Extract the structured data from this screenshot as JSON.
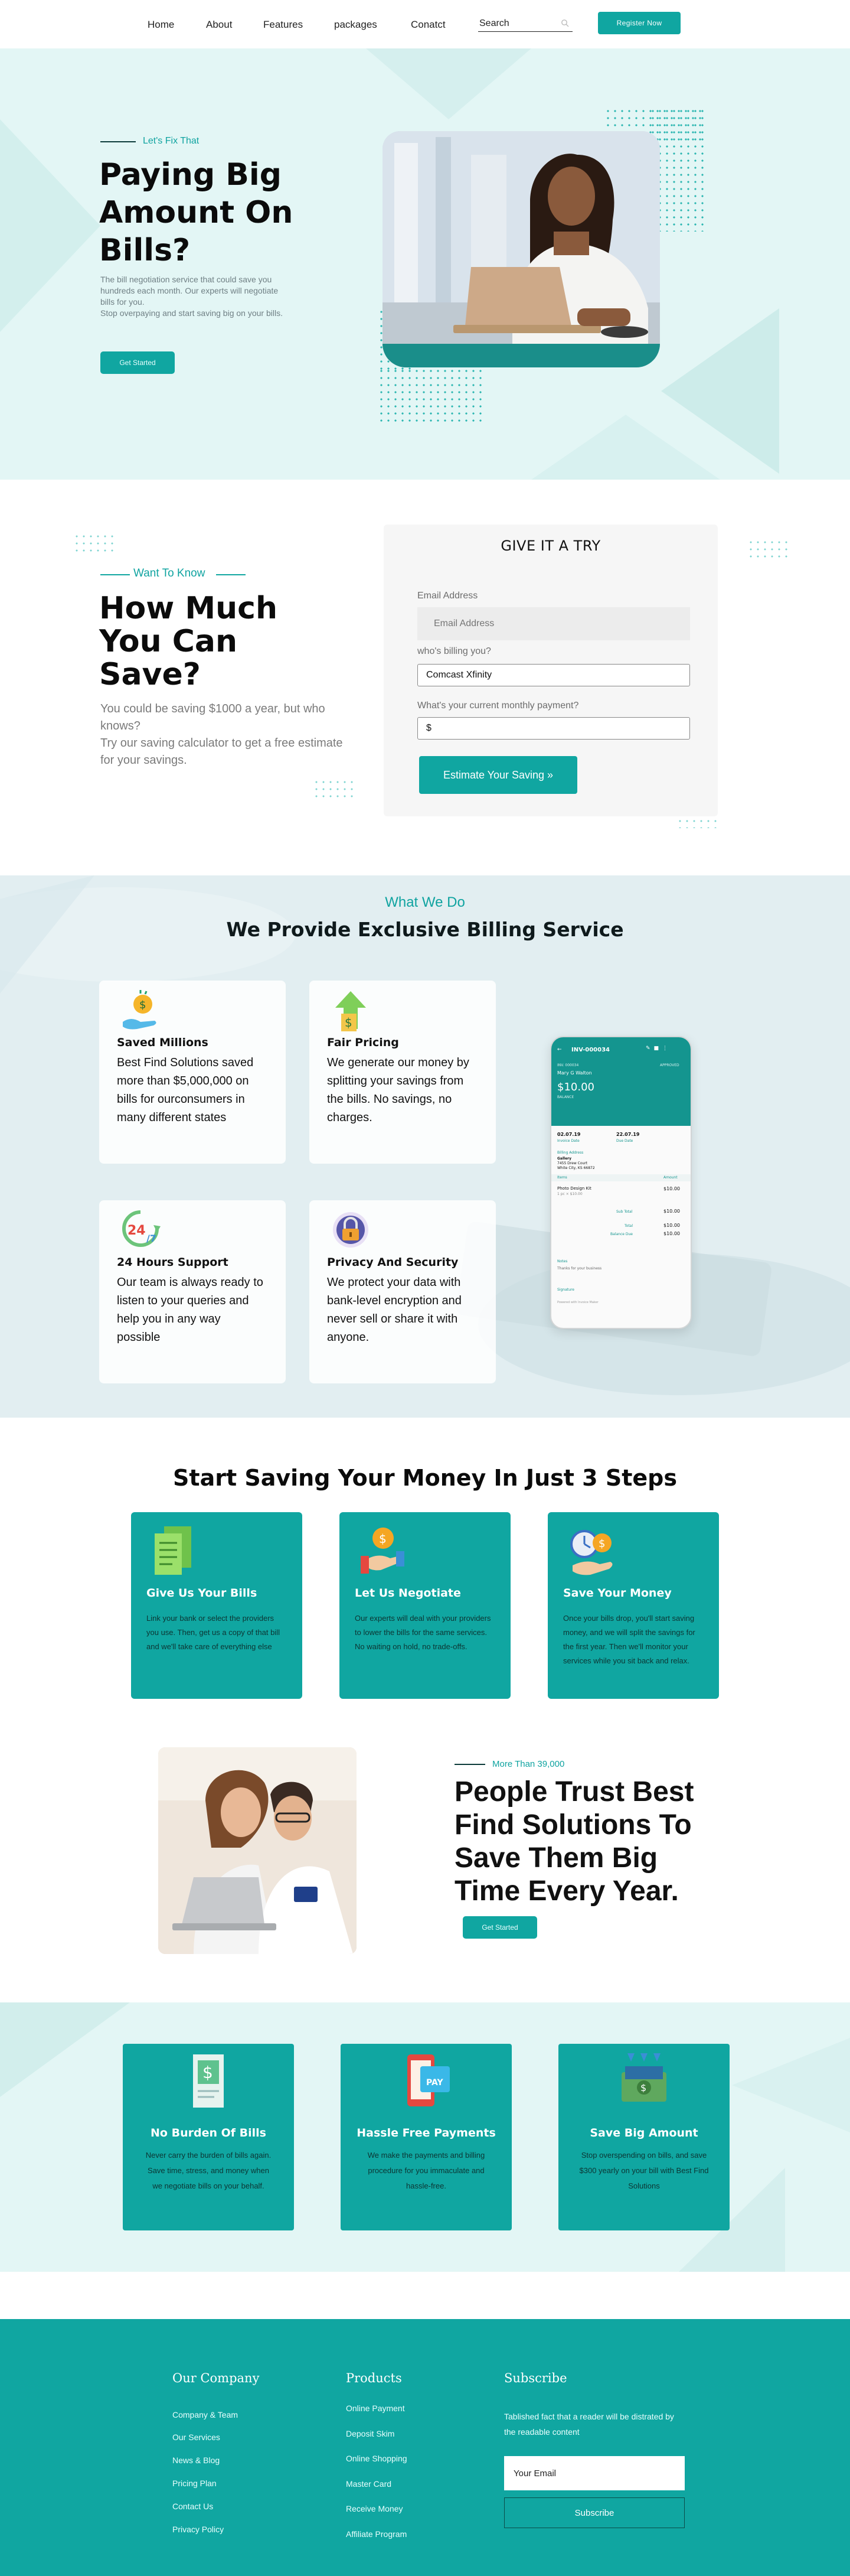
{
  "nav": {
    "links": [
      "Home",
      "About",
      "Features",
      "packages",
      "Conatct"
    ],
    "search_placeholder": "Search",
    "register_label": "Register Now"
  },
  "hero": {
    "tag": "Let's Fix That",
    "title": "Paying Big Amount On Bills?",
    "description": "The bill negotiation service that could save you hundreds each month. Our experts will negotiate bills for you.\nStop overpaying and start saving big on your bills.",
    "button_label": "Get Started"
  },
  "calculator": {
    "tag": "Want To Know",
    "title": "How Much You Can Save?",
    "description": "You could be saving $1000 a year, but who knows?\nTry our saving calculator to get a free estimate for your savings.",
    "card_title": "GIVE IT A TRY",
    "email_label": "Email Address",
    "email_placeholder": "Email Address",
    "billing_label": "who's billing you?",
    "billing_value": "Comcast Xfinity",
    "payment_label": "What's your current monthly payment?",
    "payment_value": "$",
    "button_label": "Estimate Your Saving »"
  },
  "services": {
    "tag": "What We Do",
    "title": "We Provide Exclusive Billing Service",
    "cards": [
      {
        "title": "Saved Millions",
        "text": "Best Find Solutions saved more than $5,000,000 on bills for ourconsumers in many different states",
        "icon": "money-hand-icon"
      },
      {
        "title": "Fair Pricing",
        "text": "We generate our money by splitting your savings from the bills. No savings, no charges.",
        "icon": "dollar-arrow-up-icon"
      },
      {
        "title": "24 Hours Support",
        "text": "Our team is always ready to listen to your queries and help you in any way possible",
        "icon": "support-24-7-icon"
      },
      {
        "title": "Privacy And Security",
        "text": "We protect your data with bank-level encryption and never sell or share it with anyone.",
        "icon": "lock-icon"
      }
    ],
    "phone": {
      "invoice_id": "INV-000034",
      "client_label": "INV. 000034",
      "client_name": "Mary G Walton",
      "status": "APPROVED",
      "amount": "$10.00",
      "balance_label": "BALANCE",
      "date1": "02.07.19",
      "date1_label": "Invoice Date",
      "date2": "22.07.19",
      "date2_label": "Due Date",
      "billing_label": "Billing Address",
      "billing_name": "Gallery",
      "billing_street": "7455 Drew Court",
      "billing_city": "White City, KS 66872",
      "item_header": "Items",
      "amount_header": "Amount",
      "item_name": "Photo Design Kit",
      "item_sub": "1 pc × $10.00",
      "item_amount": "$10.00",
      "subtotal_label": "Sub Total",
      "subtotal": "$10.00",
      "total_label": "Total",
      "total": "$10.00",
      "balance_due_label": "Balance Due",
      "balance_due": "$10.00",
      "notes_label": "Notes",
      "notes_text": "Thanks for your business",
      "signature_label": "Signature",
      "footer_text": "Powered with Invoice Maker"
    }
  },
  "steps": {
    "title": "Start Saving Your Money In Just 3 Steps",
    "cards": [
      {
        "title": "Give Us Your Bills",
        "text": "Link your bank or select the providers you use. Then, get us a copy of that bill and we'll take care of everything else",
        "icon": "bills-stack-icon"
      },
      {
        "title": "Let Us Negotiate",
        "text": "Our experts will deal with your providers to lower the bills for the same services. No waiting on hold, no trade-offs.",
        "icon": "coin-hand-icon"
      },
      {
        "title": "Save Your Money",
        "text": "Once your bills drop, you'll start saving money, and we will split the savings for the first year. Then we'll monitor your services while you sit back and relax.",
        "icon": "clock-coin-icon"
      }
    ]
  },
  "trust": {
    "tag": "More Than 39,000",
    "title": "People Trust Best Find Solutions To Save Them Big Time Every Year.",
    "button_label": "Get Started"
  },
  "benefits": {
    "cards": [
      {
        "title": "No Burden Of Bills",
        "text": "Never carry the burden of bills again. Save time, stress, and money when we negotiate bills on your behalf.",
        "icon": "receipt-dollar-icon"
      },
      {
        "title": "Hassle Free Payments",
        "text": "We make the payments and billing procedure for you immaculate and hassle-free.",
        "icon": "phone-pay-icon"
      },
      {
        "title": "Save Big Amount",
        "text": "Stop overspending on bills, and save $300 yearly on your bill with Best Find Solutions",
        "icon": "cash-arrows-icon"
      }
    ]
  },
  "footer": {
    "company_heading": "Our Company",
    "company_links": [
      "Company & Team",
      "Our Services",
      "News & Blog",
      "Pricing Plan",
      "Contact Us",
      "Privacy Policy"
    ],
    "products_heading": "Products",
    "products_links": [
      "Online Payment",
      "Deposit Skim",
      "Online Shopping",
      "Master Card",
      "Receive Money",
      "Affiliate Program"
    ],
    "subscribe_heading": "Subscribe",
    "subscribe_text": "Tablished fact that a reader will be distrated by the readable content",
    "email_placeholder": "Your Email",
    "subscribe_button": "Subscribe"
  },
  "colors": {
    "accent": "#10a6a1",
    "hero_bg": "#e3f6f5",
    "dark_text": "#0b0b0b"
  }
}
